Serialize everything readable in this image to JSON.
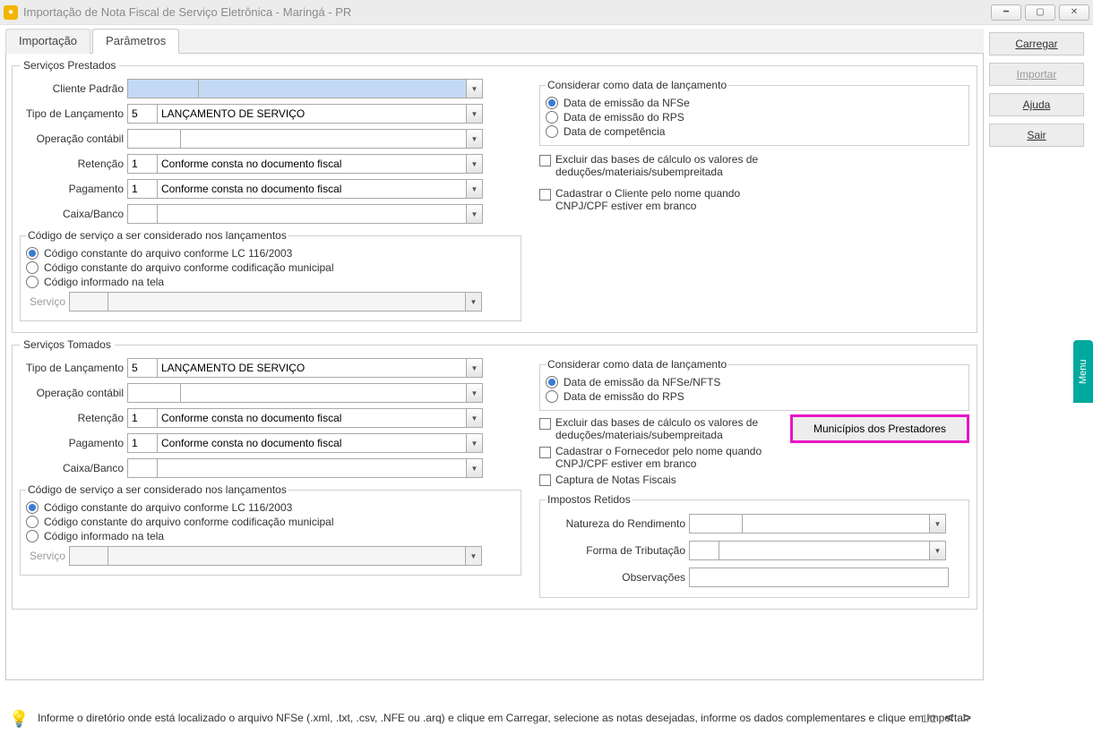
{
  "window_title": "Importação de Nota Fiscal de Serviço Eletrônica - Maringá - PR",
  "tabs": {
    "t1": "Importação",
    "t2": "Parâmetros"
  },
  "sidebar": {
    "carregar": "Carregar",
    "importar": "Importar",
    "ajuda": "Ajuda",
    "sair": "Sair"
  },
  "menu_tab": "Menu",
  "sp": {
    "legend": "Serviços Prestados",
    "cliente_padrao_lbl": "Cliente Padrão",
    "tipo_lanc_lbl": "Tipo de Lançamento",
    "tipo_lanc_cod": "5",
    "tipo_lanc_desc": "LANÇAMENTO DE SERVIÇO",
    "oper_lbl": "Operação contábil",
    "ret_lbl": "Retenção",
    "ret_cod": "1",
    "ret_desc": "Conforme consta no documento fiscal",
    "pag_lbl": "Pagamento",
    "pag_cod": "1",
    "pag_desc": "Conforme consta no documento fiscal",
    "caixa_lbl": "Caixa/Banco",
    "cod_grp": "Código de serviço a ser considerado nos lançamentos",
    "cod_r1": "Código constante do arquivo conforme LC 116/2003",
    "cod_r2": "Código constante do arquivo conforme codificação municipal",
    "cod_r3": "Código informado na tela",
    "servico_lbl": "Serviço",
    "data_grp": "Considerar como data de lançamento",
    "data_r1": "Data de emissão da NFSe",
    "data_r2": "Data de emissão do RPS",
    "data_r3": "Data de competência",
    "chk1": "Excluir das bases de cálculo os valores de deduções/materiais/subempreitada",
    "chk2": "Cadastrar o Cliente pelo nome quando CNPJ/CPF estiver em branco"
  },
  "st": {
    "legend": "Serviços Tomados",
    "tipo_lanc_lbl": "Tipo de Lançamento",
    "tipo_lanc_cod": "5",
    "tipo_lanc_desc": "LANÇAMENTO DE SERVIÇO",
    "oper_lbl": "Operação contábil",
    "ret_lbl": "Retenção",
    "ret_cod": "1",
    "ret_desc": "Conforme consta no documento fiscal",
    "pag_lbl": "Pagamento",
    "pag_cod": "1",
    "pag_desc": "Conforme consta no documento fiscal",
    "caixa_lbl": "Caixa/Banco",
    "cod_grp": "Código de serviço a ser considerado nos lançamentos",
    "cod_r1": "Código constante do arquivo conforme LC 116/2003",
    "cod_r2": "Código constante do arquivo conforme codificação municipal",
    "cod_r3": "Código informado na tela",
    "servico_lbl": "Serviço",
    "data_grp": "Considerar como data de lançamento",
    "data_r1": "Data de emissão da NFSe/NFTS",
    "data_r2": "Data de emissão do RPS",
    "chk1": "Excluir das bases de cálculo os valores de deduções/materiais/subempreitada",
    "chk2": "Cadastrar o Fornecedor pelo nome quando CNPJ/CPF estiver em branco",
    "chk3": "Captura de Notas Fiscais",
    "btn_mun": "Municípios dos Prestadores",
    "imp_grp": "Impostos Retidos",
    "nat_lbl": "Natureza do Rendimento",
    "forma_lbl": "Forma de Tributação",
    "obs_lbl": "Observações"
  },
  "footer": {
    "hint": "Informe o diretório onde está localizado o arquivo NFSe (.xml, .txt, .csv, .NFE ou .arq) e clique em Carregar, selecione as notas desejadas, informe os dados complementares e clique em Importar.",
    "page": "1/2"
  }
}
